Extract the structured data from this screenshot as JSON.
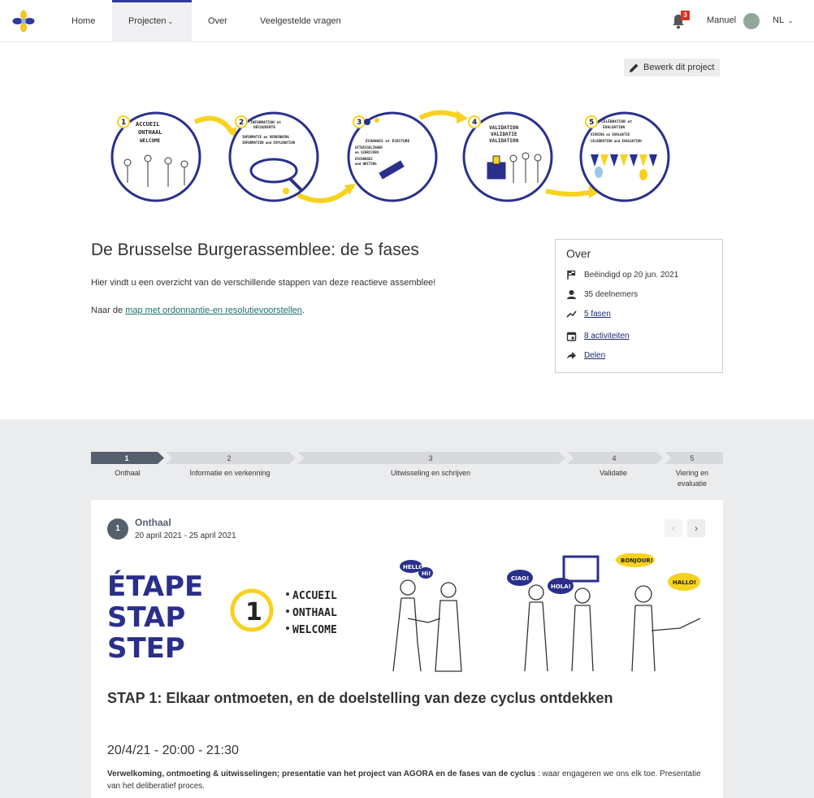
{
  "nav": {
    "items": [
      {
        "label": "Home"
      },
      {
        "label": "Projecten"
      },
      {
        "label": "Over"
      },
      {
        "label": "Veelgestelde vragen"
      }
    ],
    "notifications": "3",
    "user": "Manuel",
    "lang": "NL",
    "chevron": "⌄",
    "accent": "#2f3a9e"
  },
  "edit_button": "Bewerk dit project",
  "banner": {
    "phases": [
      {
        "num": "1",
        "lines": [
          "ACCUEIL",
          "ONTHAAL",
          "WELCOME"
        ]
      },
      {
        "num": "2",
        "lines": [
          "INFORMATION et",
          "DÉCOUVERTE",
          "INFORMATIE en VERKENNING",
          "INFORMATION and EXPLORATION"
        ]
      },
      {
        "num": "3",
        "lines": [
          "ÉCHANGES et ÉCRITURE",
          "UITWISSELINGEN",
          "en SCHRIJVEN",
          "EXCHANGES",
          "and WRITING"
        ]
      },
      {
        "num": "4",
        "lines": [
          "VALIDATION",
          "VALIDATIE",
          "VALIDATION"
        ]
      },
      {
        "num": "5",
        "lines": [
          "CÉLÉBRATION et",
          "ÉVALUATION",
          "VIERING en EVALUATIE",
          "CELEBRATION and EVALUATION"
        ]
      }
    ]
  },
  "project": {
    "title": "De Brusselse Burgerassemblee: de 5 fases",
    "description": "Hier vindt u een overzicht van de verschillende stappen van deze reactieve assemblee!",
    "link_prefix": "Naar de ",
    "link_text": "map met ordonnantie-en resolutievoorstellen",
    "link_suffix": "."
  },
  "over": {
    "title": "Over",
    "rows": [
      {
        "icon": "flag-icon",
        "text": "Beëindigd op 20 jun. 2021",
        "link": false
      },
      {
        "icon": "person-icon",
        "text": "35 deelnemers",
        "link": false
      },
      {
        "icon": "trend-icon",
        "text": "5 fasen",
        "link": true
      },
      {
        "icon": "calendar-icon",
        "text": "8 activiteiten",
        "link": true
      },
      {
        "icon": "share-icon",
        "text": "Delen",
        "link": true
      }
    ]
  },
  "stepper": [
    {
      "num": "1",
      "label": "Onthaal",
      "active": true
    },
    {
      "num": "2",
      "label": "Informatie en verkenning",
      "active": false
    },
    {
      "num": "3",
      "label": "Uitwisseling en schrijven",
      "active": false
    },
    {
      "num": "4",
      "label": "Validatie",
      "active": false
    },
    {
      "num": "5",
      "label": "Viering en evaluatie",
      "active": false
    }
  ],
  "phase_card": {
    "num": "1",
    "name": "Onthaal",
    "dates": "20 april 2021 - 25 april 2021",
    "prev": "‹",
    "next": "›",
    "illustration": {
      "etape": [
        "ÉTAPE",
        "STAP",
        "STEP"
      ],
      "num": "1",
      "lines": [
        "ACCUEIL",
        "ONTHAAL",
        "WELCOME"
      ],
      "bubbles": [
        "HELLO",
        "Hi!",
        "CIAO!",
        "HOLA!",
        "BONJOUR!",
        "HALLO!"
      ]
    },
    "heading": "STAP 1: Elkaar ontmoeten, en de doelstelling van deze cyclus ontdekken",
    "session_time": "20/4/21 - 20:00 - 21:30",
    "session_bold": "Verwelkoming, ontmoeting & uitwisselingen; presentatie van het project van AGORA en de fases van de cyclus",
    "session_rest": " : waar engageren we ons elk toe. Presentatie van het deliberatief proces."
  },
  "colors": {
    "stepper_active": "#555f6d",
    "stepper_inactive": "#d7d9dd",
    "link": "#1f6f6a",
    "yellow": "#f7d21e",
    "navy": "#2a2f8c"
  }
}
